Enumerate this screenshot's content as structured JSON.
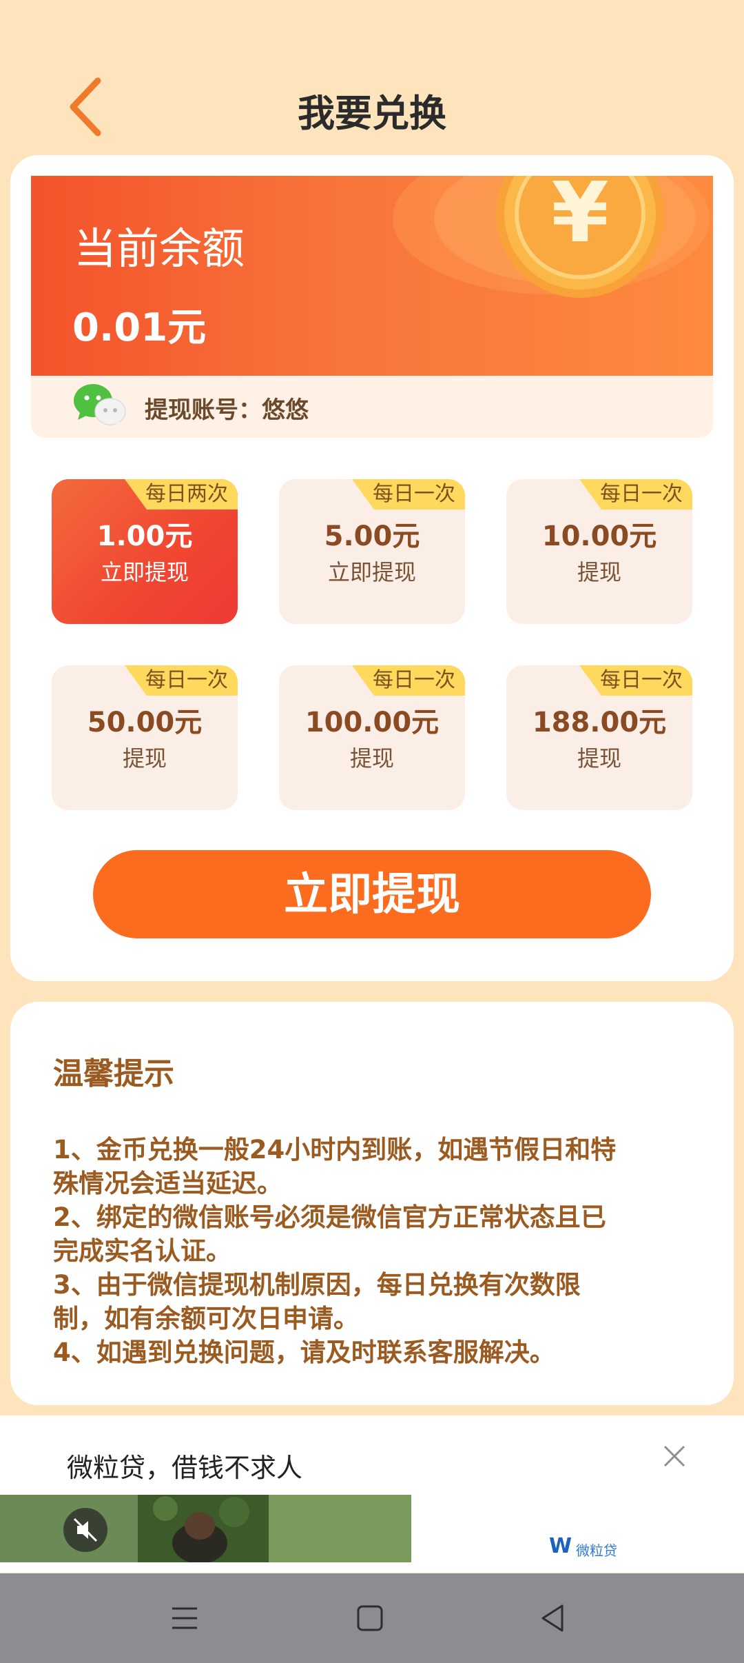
{
  "header": {
    "title": "我要兑换"
  },
  "balance": {
    "label": "当前余额",
    "value": "0.01元"
  },
  "account": {
    "label": "提现账号：悠悠"
  },
  "options": [
    {
      "tag": "每日两次",
      "amount": "1.00元",
      "action": "立即提现",
      "selected": true
    },
    {
      "tag": "每日一次",
      "amount": "5.00元",
      "action": "立即提现",
      "selected": false
    },
    {
      "tag": "每日一次",
      "amount": "10.00元",
      "action": "提现",
      "selected": false
    },
    {
      "tag": "每日一次",
      "amount": "50.00元",
      "action": "提现",
      "selected": false
    },
    {
      "tag": "每日一次",
      "amount": "100.00元",
      "action": "提现",
      "selected": false
    },
    {
      "tag": "每日一次",
      "amount": "188.00元",
      "action": "提现",
      "selected": false
    }
  ],
  "cta": {
    "label": "立即提现"
  },
  "tips": {
    "title": "温馨提示",
    "lines": [
      "1、金币兑换一般24小时内到账，如遇节假日和特",
      "殊情况会适当延迟。",
      "2、绑定的微信账号必须是微信官方正常状态且已",
      "完成实名认证。",
      "3、由于微信提现机制原因，每日兑换有次数限",
      "制，如有余额可次日申请。",
      "4、如遇到兑换问题，请及时联系客服解决。"
    ]
  },
  "ad": {
    "text": "微粒贷，借钱不求人",
    "brand": "微粒贷",
    "brand_logo": "W"
  },
  "colors": {
    "accent": "#fb6c1f",
    "background": "#fde4bd",
    "tip_text": "#9b5a1f",
    "tag": "#ffd95e"
  }
}
